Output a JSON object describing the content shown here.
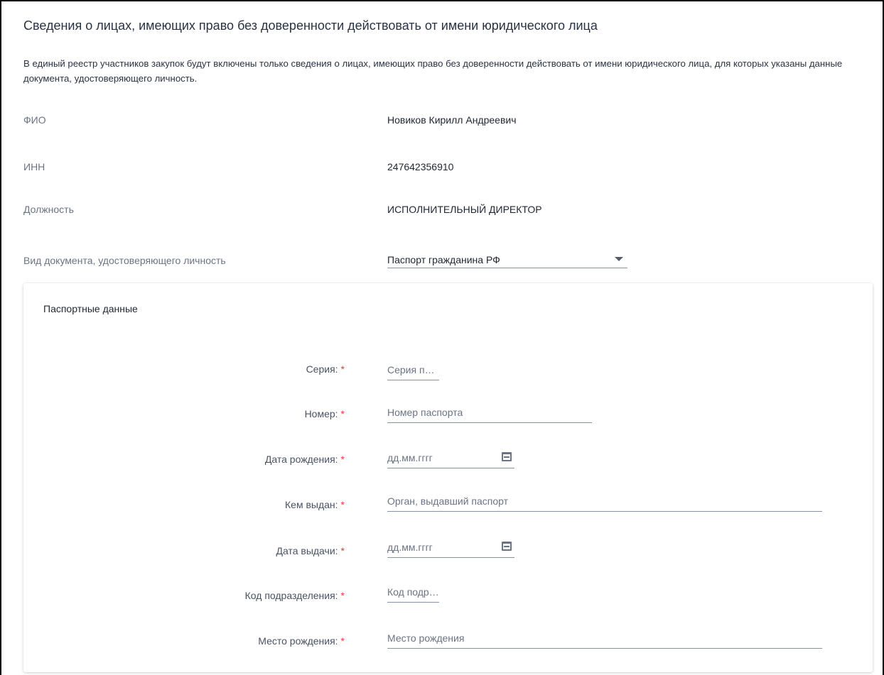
{
  "section": {
    "title": "Сведения о лицах, имеющих право без доверенности действовать от имени юридического лица",
    "notice": "В единый реестр участников закупок будут включены только сведения о лицах, имеющих право без доверенности действовать от имени юридического лица, для которых указаны данные документа, удостоверяющего личность."
  },
  "person": {
    "fio_label": "ФИО",
    "fio_value": "Новиков Кирилл Андреевич",
    "inn_label": "ИНН",
    "inn_value": "247642356910",
    "position_label": "Должность",
    "position_value": "ИСПОЛНИТЕЛЬНЫЙ ДИРЕКТОР",
    "doc_type_label": "Вид документа, удостоверяющего личность",
    "doc_type_value": "Паспорт гражданина РФ"
  },
  "passport": {
    "title": "Паспортные данные",
    "required_mark": "*",
    "fields": [
      {
        "label": "Серия:",
        "placeholder": "Серия паспорта",
        "value": ""
      },
      {
        "label": "Номер:",
        "placeholder": "Номер паспорта",
        "value": ""
      },
      {
        "label": "Дата рождения:",
        "placeholder": "дд.мм.гггг",
        "value": ""
      },
      {
        "label": "Кем выдан:",
        "placeholder": "Орган, выдавший паспорт",
        "value": ""
      },
      {
        "label": "Дата выдачи:",
        "placeholder": "дд.мм.гггг",
        "value": ""
      },
      {
        "label": "Код подразделения:",
        "placeholder": "Код подразделения",
        "value": ""
      },
      {
        "label": "Место рождения:",
        "placeholder": "Место рождения",
        "value": ""
      }
    ]
  },
  "colors": {
    "required": "#e0413a",
    "label": "#6b7484",
    "text": "#1f2633",
    "underline": "#8a93a3"
  },
  "icons": {
    "select_caret": "chevron-down-icon",
    "date_picker": "calendar-icon"
  }
}
